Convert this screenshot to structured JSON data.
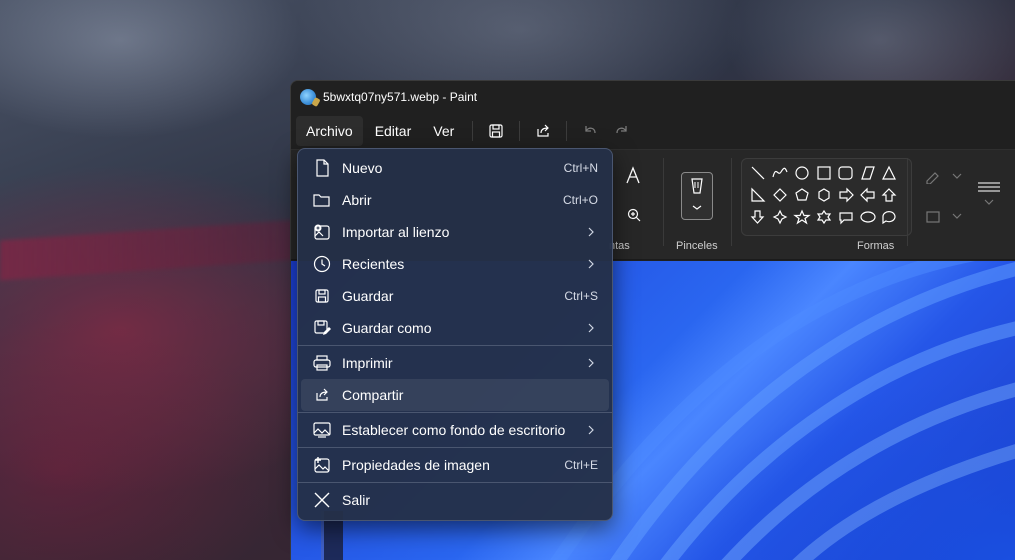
{
  "window": {
    "title": "5bwxtq07ny571.webp - Paint"
  },
  "menubar": {
    "file": "Archivo",
    "edit": "Editar",
    "view": "Ver"
  },
  "ribbon": {
    "text_group": "ntas",
    "brushes_label": "Pinceles",
    "shapes_label": "Formas"
  },
  "file_menu": {
    "items": [
      {
        "label": "Nuevo",
        "shortcut": "Ctrl+N",
        "icon": "new-file-icon"
      },
      {
        "label": "Abrir",
        "shortcut": "Ctrl+O",
        "icon": "open-folder-icon"
      },
      {
        "label": "Importar al lienzo",
        "shortcut": "",
        "icon": "import-image-icon"
      },
      {
        "label": "Recientes",
        "shortcut": "",
        "icon": "clock-icon"
      },
      {
        "label": "Guardar",
        "shortcut": "Ctrl+S",
        "icon": "save-icon"
      },
      {
        "label": "Guardar como",
        "shortcut": "",
        "icon": "save-as-icon"
      },
      {
        "label": "Imprimir",
        "shortcut": "",
        "icon": "printer-icon"
      },
      {
        "label": "Compartir",
        "shortcut": "",
        "icon": "share-icon"
      },
      {
        "label": "Establecer como fondo de escritorio",
        "shortcut": "",
        "icon": "wallpaper-icon"
      },
      {
        "label": "Propiedades de imagen",
        "shortcut": "Ctrl+E",
        "icon": "image-properties-icon"
      },
      {
        "label": "Salir",
        "shortcut": "",
        "icon": "close-icon"
      }
    ]
  },
  "colors": {
    "accent_blue": "#2a66f0",
    "menu_bg": "#243048"
  }
}
